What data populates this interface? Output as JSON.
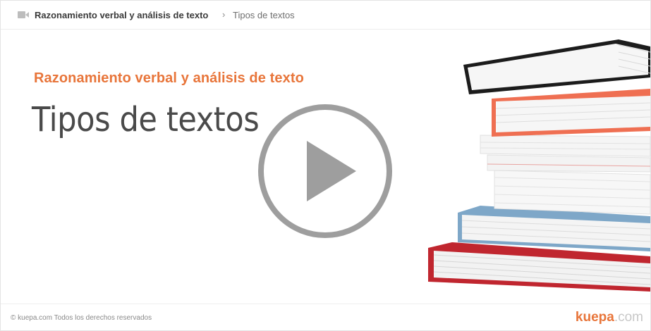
{
  "breadcrumb": {
    "course": "Razonamiento verbal y análisis de texto",
    "separator": "›",
    "topic": "Tipos de textos"
  },
  "slide": {
    "subtitle": "Razonamiento verbal y análisis de texto",
    "title": "Tipos de textos"
  },
  "player": {
    "icon": "play-icon"
  },
  "footer": {
    "copyright": "© kuepa.com Todos los derechos reservados",
    "brand_main": "kuepa",
    "brand_domain": ".com"
  },
  "colors": {
    "accent": "#e8753a",
    "play": "#9e9e9e"
  }
}
